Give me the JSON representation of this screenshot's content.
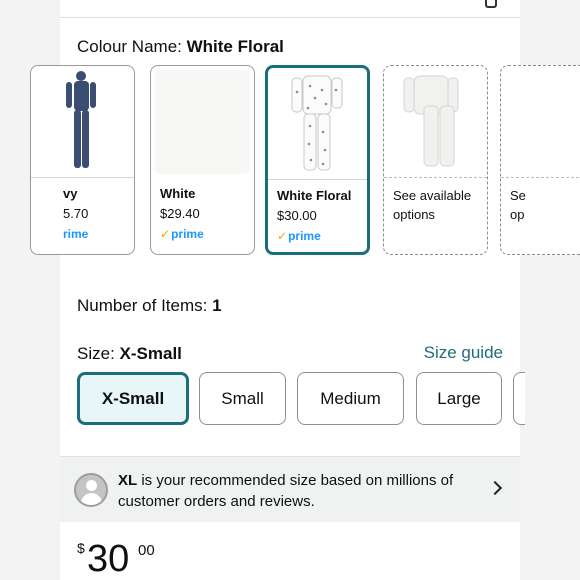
{
  "colour": {
    "label": "Colour Name:",
    "value": "White Floral"
  },
  "swatches": [
    {
      "name": "vy",
      "price": "5.70",
      "prime": "rime"
    },
    {
      "name": "White",
      "price": "$29.40",
      "prime": "prime"
    },
    {
      "name": "White Floral",
      "price": "$30.00",
      "prime": "prime"
    },
    {
      "options": "See available options"
    },
    {
      "options": "Se op"
    }
  ],
  "items": {
    "label": "Number of Items:",
    "value": "1"
  },
  "size": {
    "label": "Size:",
    "value": "X-Small",
    "guide": "Size guide",
    "options": [
      "X-Small",
      "Small",
      "Medium",
      "Large"
    ]
  },
  "recommendation": {
    "size": "XL",
    "text": "is your recommended size based on millions of customer orders and reviews."
  },
  "price": {
    "currency": "$",
    "whole": "30",
    "fraction": "00"
  },
  "colors": {
    "accent": "#1c6e78",
    "prime": "#1a98ff",
    "background": "#f3f3f3"
  }
}
